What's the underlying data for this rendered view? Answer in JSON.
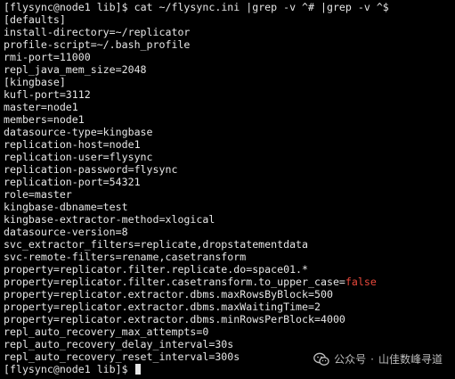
{
  "terminal": {
    "prompt": "[flysync@node1 lib]$",
    "command": "cat ~/flysync.ini |grep -v ^# |grep -v ^$",
    "output": [
      "[defaults]",
      "install-directory=~/replicator",
      "profile-script=~/.bash_profile",
      "rmi-port=11000",
      "repl_java_mem_size=2048",
      "[kingbase]",
      "kufl-port=3112",
      "master=node1",
      "members=node1",
      "datasource-type=kingbase",
      "replication-host=node1",
      "replication-user=flysync",
      "replication-password=flysync",
      "replication-port=54321",
      "role=master",
      "kingbase-dbname=test",
      "kingbase-extractor-method=xlogical",
      "datasource-version=8",
      "svc_extractor_filters=replicate,dropstatementdata",
      "svc-remote-filters=rename,casetransform",
      "property=replicator.filter.replicate.do=space01.*"
    ],
    "highlight_line": {
      "prefix": "property=replicator.filter.casetransform.to_upper_case=",
      "value": "false"
    },
    "output_after": [
      "property=replicator.extractor.dbms.maxRowsByBlock=500",
      "property=replicator.extractor.dbms.maxWaitingTime=2",
      "property=replicator.extractor.dbms.minRowsPerBlock=4000",
      "repl_auto_recovery_max_attempts=0",
      "repl_auto_recovery_delay_interval=30s",
      "repl_auto_recovery_reset_interval=300s"
    ],
    "final_prompt": "[flysync@node1 lib]$"
  },
  "watermark": {
    "icon": "wechat-icon",
    "label": "公众号",
    "separator": "·",
    "name": "山佳数峰寻道"
  },
  "colors": {
    "background": "#000000",
    "text": "#e6e6e6",
    "highlight": "#e8483b"
  }
}
